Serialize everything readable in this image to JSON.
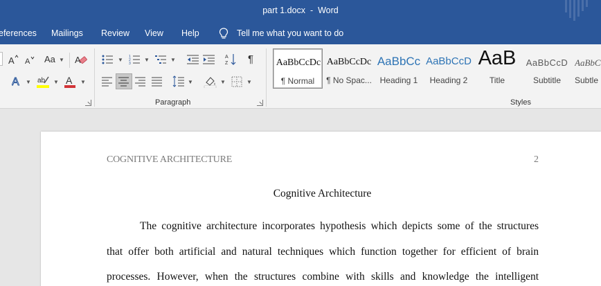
{
  "window": {
    "title": "part 1.docx  -  Word"
  },
  "menu": {
    "tabs": [
      {
        "label": "eferences"
      },
      {
        "label": "Mailings"
      },
      {
        "label": "Review"
      },
      {
        "label": "View"
      },
      {
        "label": "Help"
      }
    ],
    "tell_me": "Tell me what you want to do"
  },
  "ribbon": {
    "font_group": {
      "change_case_label": "Aa"
    },
    "paragraph_group": {
      "label": "Paragraph",
      "pilcrow": "¶",
      "alignment_selected": "center"
    },
    "styles_group": {
      "label": "Styles",
      "items": [
        {
          "preview": "AaBbCcDc",
          "name": "¶ Normal"
        },
        {
          "preview": "AaBbCcDc",
          "name": "¶ No Spac..."
        },
        {
          "preview": "AaBbCc",
          "name": "Heading 1"
        },
        {
          "preview": "AaBbCcD",
          "name": "Heading 2"
        },
        {
          "preview": "AaB",
          "name": "Title"
        },
        {
          "preview": "AaBbCcD",
          "name": "Subtitle"
        },
        {
          "preview": "AaBbCcD",
          "name": "Subtle"
        }
      ]
    },
    "colors": {
      "highlight": "#ffff00",
      "font_color": "#d13438",
      "accent": "#2b579a"
    }
  },
  "document": {
    "header_left": "COGNITIVE ARCHITECTURE",
    "page_number": "2",
    "title": "Cognitive Architecture",
    "lines": [
      "The cognitive architecture incorporates hypothesis which depicts some of the structures",
      "that offer both artificial and natural techniques which function together for efficient of brain",
      "processes. However, when the structures combine with skills and knowledge the intelligent"
    ]
  }
}
